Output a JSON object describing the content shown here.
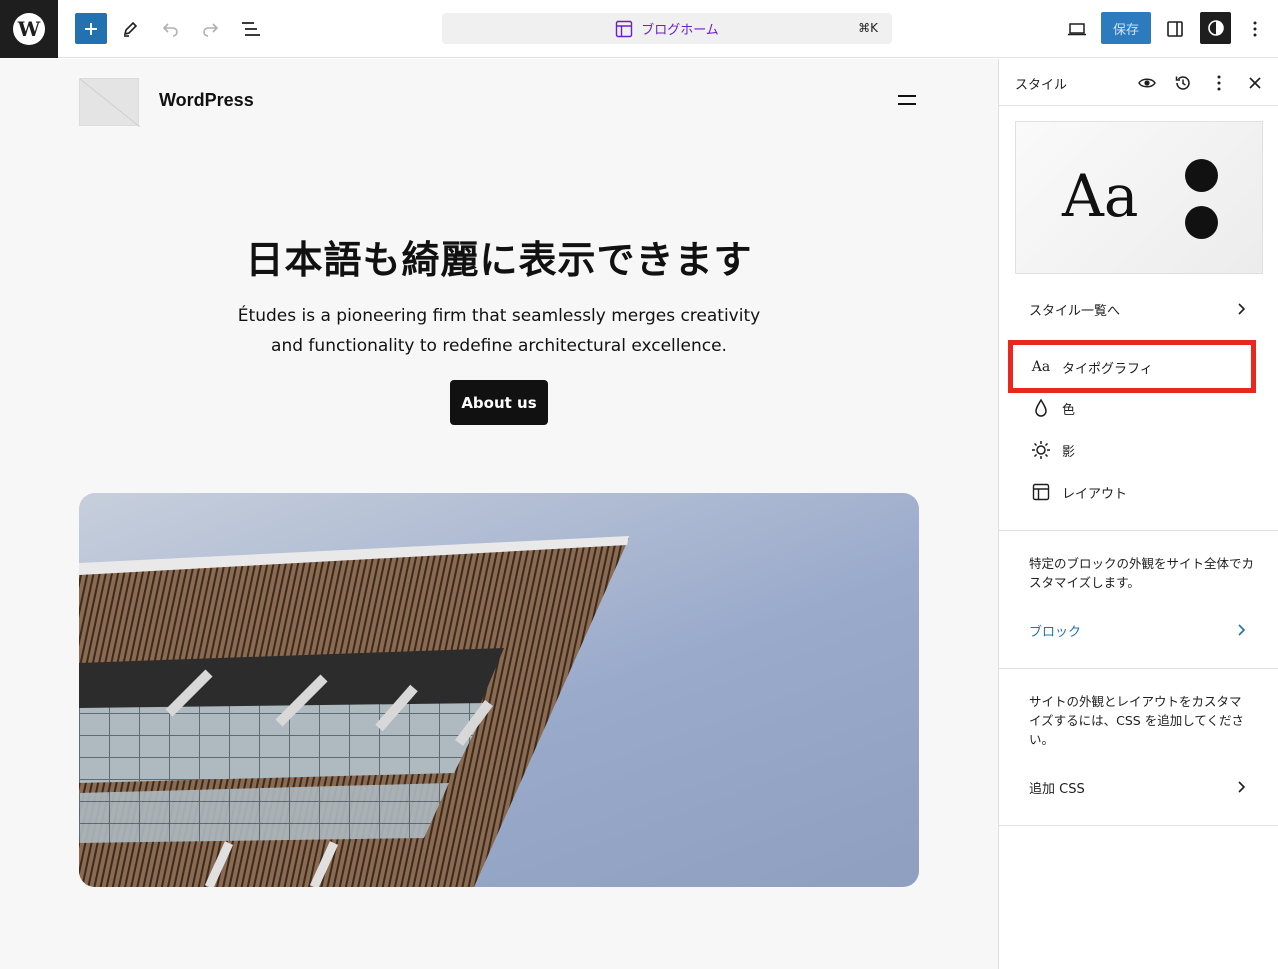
{
  "toolbar": {
    "document_title": "ブログホーム",
    "shortcut": "⌘K",
    "save_label": "保存"
  },
  "canvas": {
    "site_title": "WordPress",
    "hero_heading": "日本語も綺麗に表示できます",
    "hero_text": "Études is a pioneering firm that seamlessly merges creativity and functionality to redefine architectural excellence.",
    "about_button": "About us"
  },
  "sidebar": {
    "title": "スタイル",
    "preview_text": "Aa",
    "browse_styles": "スタイル一覧へ",
    "menu": [
      {
        "label": "タイポグラフィ",
        "icon": "typography-icon"
      },
      {
        "label": "色",
        "icon": "color-drop-icon"
      },
      {
        "label": "影",
        "icon": "shadow-sun-icon"
      },
      {
        "label": "レイアウト",
        "icon": "layout-icon"
      }
    ],
    "blocks_desc": "特定のブロックの外観をサイト全体でカスタマイズします。",
    "blocks_link": "ブロック",
    "css_desc": "サイトの外観とレイアウトをカスタマイズするには、CSS を追加してください。",
    "css_link": "追加 CSS"
  },
  "colors": {
    "accent": "#2271b1",
    "doc_title": "#6b21c8",
    "highlight": "#e8281f"
  }
}
